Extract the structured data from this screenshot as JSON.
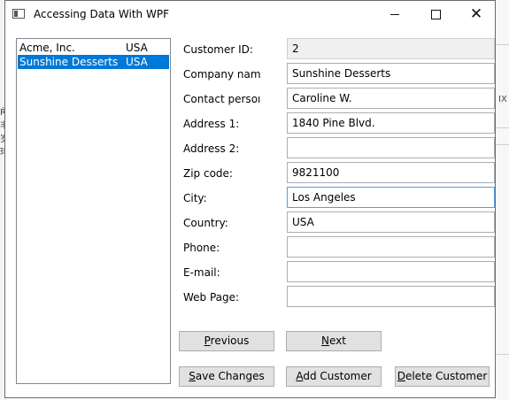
{
  "window": {
    "title": "Accessing Data With WPF"
  },
  "customers_list": [
    {
      "name": "Acme, Inc.",
      "country": "USA",
      "selected": false
    },
    {
      "name": "Sunshine Desserts",
      "country": "USA",
      "selected": true
    }
  ],
  "form": {
    "customer_id": {
      "label": "Customer ID:",
      "value": "2"
    },
    "company_name": {
      "label": "Company nam",
      "value": "Sunshine Desserts"
    },
    "contact_person": {
      "label": "Contact persoı",
      "value": "Caroline W."
    },
    "address1": {
      "label": "Address 1:",
      "value": "1840 Pine Blvd."
    },
    "address2": {
      "label": "Address 2:",
      "value": ""
    },
    "zip_code": {
      "label": "Zip code:",
      "value": "9821100"
    },
    "city": {
      "label": "City:",
      "value": "Los Angeles"
    },
    "country": {
      "label": "Country:",
      "value": "USA"
    },
    "phone": {
      "label": "Phone:",
      "value": ""
    },
    "email": {
      "label": "E-mail:",
      "value": ""
    },
    "web_page": {
      "label": "Web Page:",
      "value": ""
    }
  },
  "buttons": {
    "previous": {
      "accel": "P",
      "rest": "revious"
    },
    "next": {
      "accel": "N",
      "rest": "ext"
    },
    "save": {
      "accel": "S",
      "rest": "ave Changes"
    },
    "add": {
      "accel": "A",
      "rest": "dd Customer"
    },
    "delete": {
      "accel": "D",
      "rest": "elete Customer"
    }
  },
  "background_fragments": {
    "left_text": "Ŕ 丰 岁 玤",
    "right_text": "IX"
  }
}
